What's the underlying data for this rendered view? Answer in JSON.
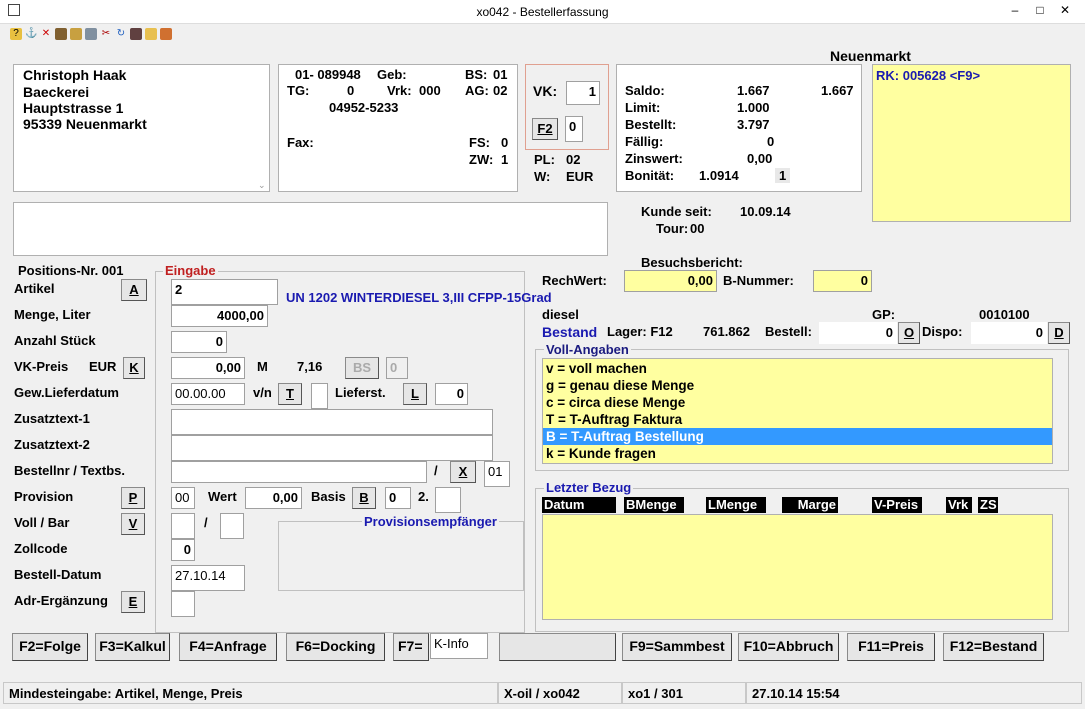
{
  "window": {
    "title": "xo042 - Bestellerfassung",
    "min": "–",
    "max": "□",
    "close": "✕"
  },
  "section_label": "Neuenmarkt",
  "address": [
    "Christoph Haak",
    "Baeckerei",
    "Hauptstrasse 1",
    "95339 Neuenmarkt"
  ],
  "cust": {
    "nr": "01- 089948",
    "geb_label": "Geb:",
    "bs_label": "BS:",
    "bs": "01",
    "tg_label": "TG:",
    "tg": "0",
    "vrk_label": "Vrk:",
    "vrk": "000",
    "ag_label": "AG:",
    "ag": "02",
    "phone": "04952-5233",
    "fax_label": "Fax:",
    "fs_label": "FS:",
    "fs": "0",
    "zw_label": "ZW:",
    "zw": "1"
  },
  "vk": {
    "label": "VK:",
    "value": "1",
    "f2": "F2",
    "f2_value": "0",
    "pl_label": "PL:",
    "pl": "02",
    "w_label": "W:",
    "w": "EUR"
  },
  "finance": {
    "saldo_label": "Saldo:",
    "saldo": "1.667",
    "saldo2": "1.667",
    "limit_label": "Limit:",
    "limit": "1.000",
    "bestellt_label": "Bestellt:",
    "bestellt": "3.797",
    "faellig_label": "Fällig:",
    "faellig": "0",
    "zinswert_label": "Zinswert:",
    "zinswert": "0,00",
    "bonitaet_label": "Bonität:",
    "bonitaet": "1.0914",
    "bonitaet2": "1"
  },
  "rk": "RK: 005628 <F9>",
  "kunde_seit_label": "Kunde seit:",
  "kunde_seit": "10.09.14",
  "tour_label": "Tour:",
  "tour": "00",
  "besuchsbericht": "Besuchsbericht:",
  "rechwert_label": "RechWert:",
  "rechwert": "0,00",
  "bnummer_label": "B-Nummer:",
  "bnummer": "0",
  "positions": "Positions-Nr. 001",
  "eingabe": "Eingabe",
  "form": {
    "artikel": "Artikel",
    "artikel_btn": "A",
    "artikel_val": "2",
    "artikel_desc": "UN 1202 WINTERDIESEL 3,III CFPP-15Grad",
    "menge": "Menge, Liter",
    "menge_val": "4000,00",
    "anzahl": "Anzahl Stück",
    "anzahl_val": "0",
    "vkpreis": "VK-Preis",
    "eur": "EUR",
    "k_btn": "K",
    "vkpreis_val": "0,00",
    "m": "M",
    "m_val": "7,16",
    "bs_btn": "BS",
    "bs_val": "0",
    "gew": "Gew.Lieferdatum",
    "gew_val": "00.00.00",
    "vn": "v/n",
    "t_btn": "T",
    "lieferst": "Lieferst.",
    "l_btn": "L",
    "lieferst_val": "0",
    "zusatz1": "Zusatztext-1",
    "zusatz2": "Zusatztext-2",
    "bestellnr": "Bestellnr / Textbs.",
    "slash": "/",
    "x_btn": "X",
    "bestellnr_val": "01",
    "provision": "Provision",
    "p_btn": "P",
    "prov_val": "00",
    "wert": "Wert",
    "wert_val": "0,00",
    "basis": "Basis",
    "b_btn": "B",
    "basis_val": "0",
    "zwei": "2.",
    "vollbar": "Voll / Bar",
    "v_btn": "V",
    "vb_slash": "/",
    "zollcode": "Zollcode",
    "zollcode_val": "0",
    "bestelldatum": "Bestell-Datum",
    "bestelldatum_val": "27.10.14",
    "adr": "Adr-Ergänzung",
    "e_btn": "E",
    "provempf": "Provisionsempfänger"
  },
  "product": {
    "name": "diesel",
    "gp_label": "GP:",
    "gp": "0010100",
    "bestand": "Bestand",
    "lager_label": "Lager: F12",
    "lager": "761.862",
    "bestell_label": "Bestell:",
    "bestell": "0",
    "o_btn": "O",
    "dispo_label": "Dispo:",
    "dispo": "0",
    "d_btn": "D"
  },
  "voll": {
    "title": "Voll-Angaben",
    "items": [
      "v = voll machen",
      "g = genau diese Menge",
      "c = circa diese Menge",
      "T = T-Auftrag Faktura",
      "B = T-Auftrag Bestellung",
      "k = Kunde fragen"
    ],
    "selected": 4
  },
  "letzter": {
    "title": "Letzter Bezug",
    "headers": [
      "Datum",
      "BMenge",
      "LMenge",
      "Marge",
      "V-Preis",
      "Vrk",
      "ZS"
    ]
  },
  "fkeys": {
    "f2": "F2=Folge",
    "f3": "F3=Kalkul",
    "f4": "F4=Anfrage",
    "f6": "F6=Docking",
    "f7": "F7=",
    "f7_val": "K-Info",
    "f9": "F9=Sammbest",
    "f10": "F10=Abbruch",
    "f11": "F11=Preis",
    "f12": "F12=Bestand"
  },
  "status": {
    "hint": "Mindesteingabe: Artikel, Menge, Preis",
    "app": "X-oil / xo042",
    "user": "xo1 / 301",
    "time": "27.10.14 15:54"
  },
  "colors": {
    "yellow": "#ffffa0",
    "select": "#3399ff",
    "blue": "#1a1ab0",
    "red": "#c02020"
  }
}
